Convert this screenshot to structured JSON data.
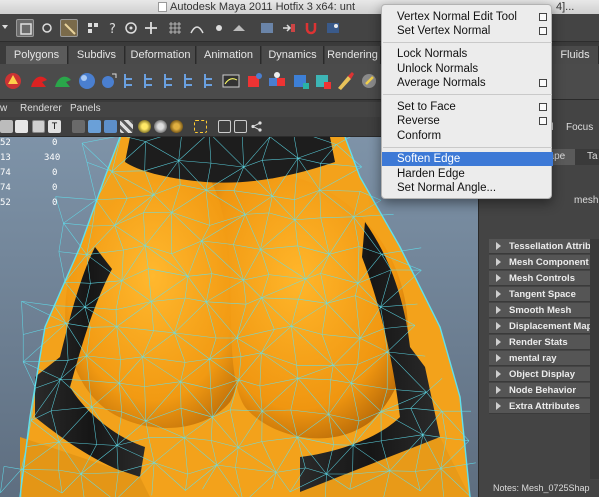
{
  "window": {
    "title": "Autodesk Maya 2011 Hotfix 3 x64: unt",
    "title_suffix": "4]..."
  },
  "shelf_tabs": [
    "Polygons",
    "Subdivs",
    "Deformation",
    "Animation",
    "Dynamics",
    "Rendering",
    "Fluids"
  ],
  "panel_menu": [
    "w",
    "Renderer",
    "Panels"
  ],
  "hud": [
    {
      "a": "52",
      "b": "0"
    },
    {
      "a": "13",
      "b": "340"
    },
    {
      "a": "74",
      "b": "0"
    },
    {
      "a": "74",
      "b": "0"
    },
    {
      "a": "52",
      "b": "0"
    }
  ],
  "context_menu": {
    "items": [
      {
        "label": "Vertex Normal Edit Tool",
        "option_box": true
      },
      {
        "label": "Set Vertex Normal",
        "option_box": true
      },
      {
        "label": "Lock Normals",
        "option_box": false
      },
      {
        "label": "Unlock Normals",
        "option_box": false
      },
      {
        "label": "Average Normals",
        "option_box": true
      },
      {
        "label": "Set to Face",
        "option_box": true
      },
      {
        "label": "Reverse",
        "option_box": true
      },
      {
        "label": "Conform",
        "option_box": false
      },
      {
        "label": "Soften Edge",
        "option_box": false,
        "highlighted": true
      },
      {
        "label": "Harden Edge",
        "option_box": false
      },
      {
        "label": "Set Normal Angle...",
        "option_box": false
      }
    ]
  },
  "attribute_editor": {
    "focus_label": "Focus",
    "focus_prefix": "d",
    "tabs": [
      "hape",
      "Ta"
    ],
    "mesh_label": "mesh",
    "sections": [
      "Tessellation Attrib",
      "Mesh Component I",
      "Mesh Controls",
      "Tangent Space",
      "Smooth Mesh",
      "Displacement Map",
      "Render Stats",
      "mental ray",
      "Object Display",
      "Node Behavior",
      "Extra Attributes"
    ],
    "notes": "Notes:  Mesh_0725Shap"
  },
  "colors": {
    "highlight": "#3d79d6",
    "mesh_fill": "#f2a21a",
    "wire": "#5ad8e6",
    "band": "#1c1c1c"
  }
}
